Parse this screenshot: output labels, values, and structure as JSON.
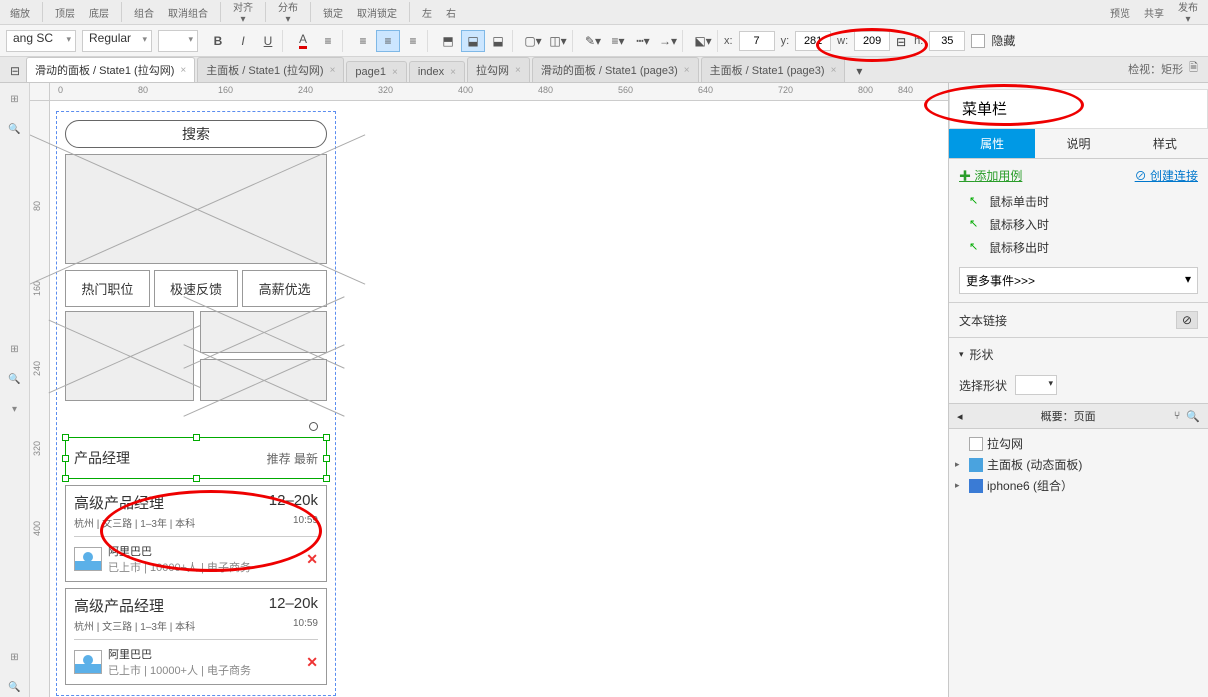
{
  "ribbon": {
    "items": [
      "缩放",
      "顶层",
      "底层",
      "组合",
      "取消组合",
      "对齐",
      "分布",
      "锁定",
      "取消锁定",
      "左",
      "右",
      "预览",
      "共享",
      "发布"
    ]
  },
  "fmt": {
    "font_family": "ang SC",
    "font_style": "Regular",
    "x_label": "x:",
    "x_value": "7",
    "y_label": "y:",
    "y_value": "281",
    "w_label": "w:",
    "w_value": "209",
    "h_label": "h:",
    "h_value": "35",
    "hide": "隐藏"
  },
  "tabs": [
    {
      "label": "滑动的面板 / State1 (拉勾网)",
      "active": true
    },
    {
      "label": "主面板 / State1 (拉勾网)",
      "active": false
    },
    {
      "label": "page1",
      "active": false
    },
    {
      "label": "index",
      "active": false
    },
    {
      "label": "拉勾网",
      "active": false
    },
    {
      "label": "滑动的面板 / State1 (page3)",
      "active": false
    },
    {
      "label": "主面板 / State1 (page3)",
      "active": false
    }
  ],
  "tabbar_right": "检视：矩形",
  "ruler_h": [
    "0",
    "80",
    "160",
    "240",
    "320",
    "400",
    "480",
    "560",
    "640",
    "720",
    "800",
    "840"
  ],
  "ruler_v": [
    "80",
    "160",
    "240",
    "320",
    "400"
  ],
  "canvas": {
    "search": "搜索",
    "tabs3": [
      "热门职位",
      "极速反馈",
      "高薪优选"
    ],
    "selected": {
      "title": "产品经理",
      "right": "推荐 最新"
    },
    "job": {
      "title": "高级产品经理",
      "salary": "12–20k",
      "meta": "杭州 | 文三路 | 1–3年 | 本科",
      "time": "10:59",
      "company": "阿里巴巴",
      "company_meta": "已上市 | 10000+人 | 电子商务"
    }
  },
  "inspector": {
    "name": "菜单栏",
    "tabs": [
      "属性",
      "说明",
      "样式"
    ],
    "add_case": "添加用例",
    "create_link": "创建连接",
    "events": [
      "鼠标单击时",
      "鼠标移入时",
      "鼠标移出时"
    ],
    "more_events": "更多事件>>>",
    "text_link": "文本链接",
    "shape_hd": "形状",
    "select_shape": "选择形状",
    "outline_title": "概要：页面",
    "tree": [
      {
        "label": "拉勾网",
        "icon": "file",
        "indent": 0,
        "arrow": ""
      },
      {
        "label": "主面板 (动态面板)",
        "icon": "panel",
        "indent": 0,
        "arrow": "▸"
      },
      {
        "label": "iphone6 (组合）",
        "icon": "folder",
        "indent": 0,
        "arrow": "▸"
      }
    ]
  }
}
